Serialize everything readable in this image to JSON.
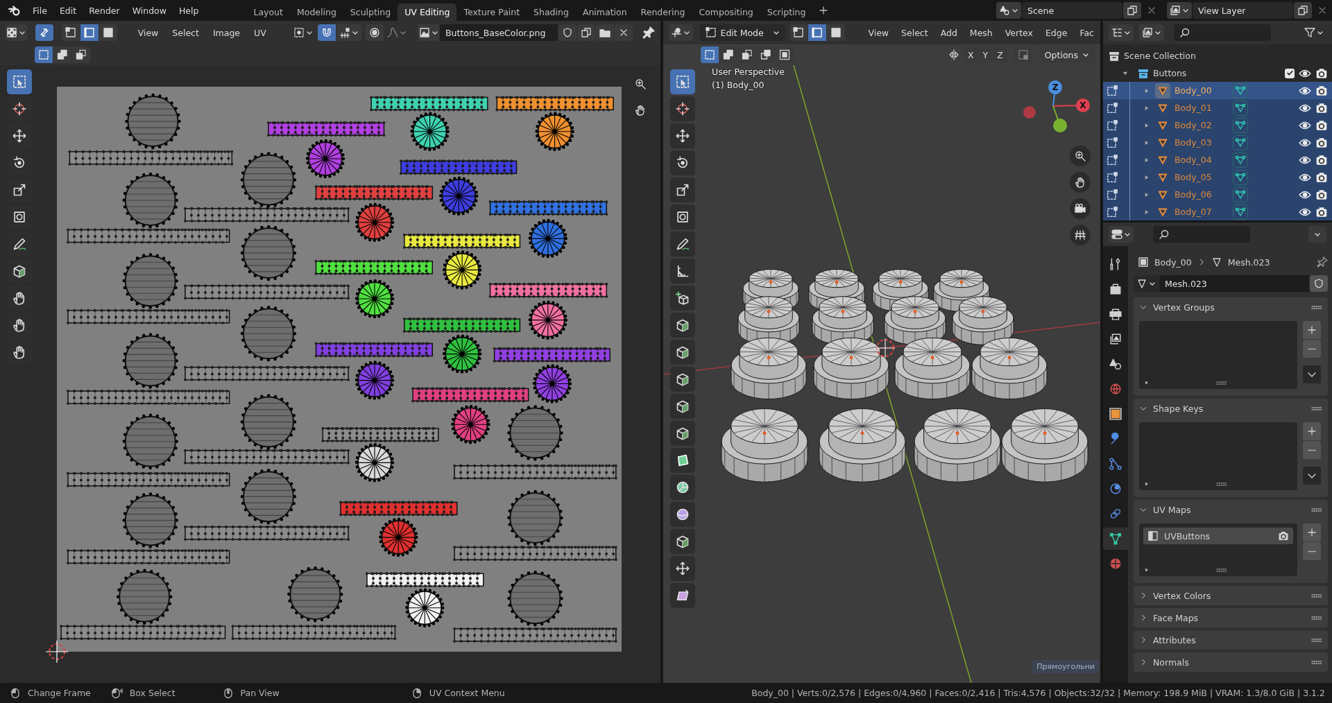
{
  "top_bar": {
    "menus": [
      "File",
      "Edit",
      "Render",
      "Window",
      "Help"
    ],
    "workspaces": [
      {
        "label": "Layout",
        "selected": false
      },
      {
        "label": "Modeling",
        "selected": false
      },
      {
        "label": "Sculpting",
        "selected": false
      },
      {
        "label": "UV Editing",
        "selected": true
      },
      {
        "label": "Texture Paint",
        "selected": false
      },
      {
        "label": "Shading",
        "selected": false
      },
      {
        "label": "Animation",
        "selected": false
      },
      {
        "label": "Rendering",
        "selected": false
      },
      {
        "label": "Compositing",
        "selected": false
      },
      {
        "label": "Scripting",
        "selected": false
      }
    ],
    "scene": "Scene",
    "view_layer": "View Layer"
  },
  "uv_editor": {
    "sync_selection": true,
    "select_modes": [
      {
        "kind": "vertex",
        "selected": false
      },
      {
        "kind": "edge",
        "selected": true
      },
      {
        "kind": "face",
        "selected": false
      }
    ],
    "menus": [
      "View",
      "Select",
      "Image",
      "UV"
    ],
    "snap": true,
    "image_name": "Buttons_BaseColor.png",
    "box_modes": [
      {
        "kind": "set",
        "selected": true
      },
      {
        "kind": "extend",
        "selected": false
      },
      {
        "kind": "subtract",
        "selected": false
      }
    ],
    "tools": [
      {
        "kind": "select",
        "selected": true
      },
      {
        "kind": "cursor",
        "selected": false
      },
      {
        "kind": "move",
        "selected": false
      },
      {
        "kind": "rotate",
        "selected": false
      },
      {
        "kind": "scale",
        "selected": false
      },
      {
        "kind": "transform",
        "selected": false
      },
      {
        "kind": "annotate",
        "selected": false
      },
      {
        "kind": "cube",
        "selected": false
      },
      {
        "kind": "hand",
        "selected": false
      },
      {
        "kind": "hand",
        "selected": false
      },
      {
        "kind": "hand",
        "selected": false
      }
    ]
  },
  "viewport": {
    "mode": "Edit Mode",
    "select_modes": [
      {
        "kind": "vertex",
        "selected": false
      },
      {
        "kind": "edge",
        "selected": true
      },
      {
        "kind": "face",
        "selected": false
      }
    ],
    "menus": [
      "View",
      "Select",
      "Add",
      "Mesh",
      "Vertex",
      "Edge",
      "Fac"
    ],
    "box_modes": [
      {
        "kind": "set",
        "selected": true
      },
      {
        "kind": "extend",
        "selected": false
      },
      {
        "kind": "subtract",
        "selected": false
      },
      {
        "kind": "invert",
        "selected": false
      },
      {
        "kind": "intersect",
        "selected": false
      }
    ],
    "mirror_axes": [
      "X",
      "Y",
      "Z"
    ],
    "snap": false,
    "options": "Options",
    "overlay_text": [
      "User Perspective",
      "(1) Body_00"
    ],
    "gizmo_labels": [
      "Z",
      "X"
    ],
    "tools": [
      {
        "kind": "select",
        "selected": true
      },
      {
        "kind": "cursor",
        "selected": false
      },
      {
        "kind": "move",
        "selected": false
      },
      {
        "kind": "rotate",
        "selected": false
      },
      {
        "kind": "scale",
        "selected": false
      },
      {
        "kind": "transform",
        "selected": false
      },
      {
        "kind": "annotate",
        "selected": false
      },
      {
        "kind": "measure",
        "selected": false
      },
      {
        "kind": "add_cube",
        "selected": false
      },
      {
        "kind": "cube",
        "selected": false
      },
      {
        "kind": "cube",
        "selected": false
      },
      {
        "kind": "cube",
        "selected": false
      },
      {
        "kind": "cube",
        "selected": false
      },
      {
        "kind": "cube",
        "selected": false
      },
      {
        "kind": "poly",
        "selected": false
      },
      {
        "kind": "spin",
        "selected": false
      },
      {
        "kind": "sphere",
        "selected": false
      },
      {
        "kind": "cube",
        "selected": false
      },
      {
        "kind": "move",
        "selected": false
      },
      {
        "kind": "shear",
        "selected": false
      }
    ],
    "operator_panel": "Прямоугольни"
  },
  "outliner": {
    "root": "Scene Collection",
    "collection": {
      "name": "Buttons",
      "expanded": true,
      "checked": true,
      "objects": [
        {
          "name": "Body_00",
          "selected": true,
          "active": true
        },
        {
          "name": "Body_01",
          "selected": true,
          "active": false
        },
        {
          "name": "Body_02",
          "selected": true,
          "active": false
        },
        {
          "name": "Body_03",
          "selected": true,
          "active": false
        },
        {
          "name": "Body_04",
          "selected": true,
          "active": false
        },
        {
          "name": "Body_05",
          "selected": true,
          "active": false
        },
        {
          "name": "Body_06",
          "selected": true,
          "active": false
        },
        {
          "name": "Body_07",
          "selected": true,
          "active": false
        }
      ]
    }
  },
  "properties": {
    "tabs": [
      {
        "kind": "tool",
        "selected": false
      },
      {
        "kind": "render",
        "selected": false
      },
      {
        "kind": "output",
        "selected": false
      },
      {
        "kind": "view_layer",
        "selected": false
      },
      {
        "kind": "scene",
        "selected": false
      },
      {
        "kind": "world",
        "selected": false
      },
      {
        "kind": "object",
        "selected": false
      },
      {
        "kind": "modifiers",
        "selected": false
      },
      {
        "kind": "particles",
        "selected": false
      },
      {
        "kind": "physics",
        "selected": false
      },
      {
        "kind": "constraints",
        "selected": false
      },
      {
        "kind": "data",
        "selected": true
      },
      {
        "kind": "material",
        "selected": false
      }
    ],
    "object": "Body_00",
    "mesh": "Mesh.023",
    "datablock": "Mesh.023",
    "panels": [
      {
        "title": "Vertex Groups",
        "expanded": true
      },
      {
        "title": "Shape Keys",
        "expanded": true
      },
      {
        "title": "UV Maps",
        "expanded": true,
        "items": [
          {
            "name": "UVButtons",
            "selected": true
          }
        ]
      },
      {
        "title": "Vertex Colors",
        "expanded": false
      },
      {
        "title": "Face Maps",
        "expanded": false
      },
      {
        "title": "Attributes",
        "expanded": false
      },
      {
        "title": "Normals",
        "expanded": false
      }
    ]
  },
  "status_bar": {
    "hints": [
      {
        "kind": "left",
        "label": "Change Frame"
      },
      {
        "kind": "left_drag",
        "label": "Box Select"
      },
      {
        "kind": "middle",
        "label": "Pan View"
      },
      {
        "kind": "right",
        "label": "UV Context Menu"
      }
    ],
    "stats": "Body_00 | Verts:0/2,576 | Edges:0/4,960 | Faces:0/2,416 | Tris:4,576 | Objects:32/32 | Memory: 198.9 MiB | VRAM: 1.3/8.0 GiB | 3.1.2"
  }
}
